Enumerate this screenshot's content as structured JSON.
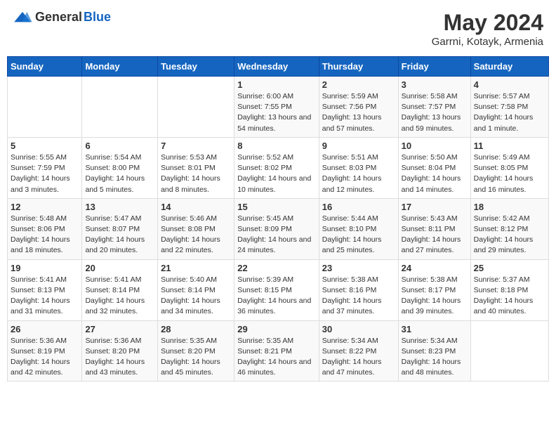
{
  "header": {
    "logo_general": "General",
    "logo_blue": "Blue",
    "title": "May 2024",
    "subtitle": "Garrni, Kotayk, Armenia"
  },
  "days_of_week": [
    "Sunday",
    "Monday",
    "Tuesday",
    "Wednesday",
    "Thursday",
    "Friday",
    "Saturday"
  ],
  "weeks": [
    [
      {
        "day": "",
        "sunrise": "",
        "sunset": "",
        "daylight": ""
      },
      {
        "day": "",
        "sunrise": "",
        "sunset": "",
        "daylight": ""
      },
      {
        "day": "",
        "sunrise": "",
        "sunset": "",
        "daylight": ""
      },
      {
        "day": "1",
        "sunrise": "Sunrise: 6:00 AM",
        "sunset": "Sunset: 7:55 PM",
        "daylight": "Daylight: 13 hours and 54 minutes."
      },
      {
        "day": "2",
        "sunrise": "Sunrise: 5:59 AM",
        "sunset": "Sunset: 7:56 PM",
        "daylight": "Daylight: 13 hours and 57 minutes."
      },
      {
        "day": "3",
        "sunrise": "Sunrise: 5:58 AM",
        "sunset": "Sunset: 7:57 PM",
        "daylight": "Daylight: 13 hours and 59 minutes."
      },
      {
        "day": "4",
        "sunrise": "Sunrise: 5:57 AM",
        "sunset": "Sunset: 7:58 PM",
        "daylight": "Daylight: 14 hours and 1 minute."
      }
    ],
    [
      {
        "day": "5",
        "sunrise": "Sunrise: 5:55 AM",
        "sunset": "Sunset: 7:59 PM",
        "daylight": "Daylight: 14 hours and 3 minutes."
      },
      {
        "day": "6",
        "sunrise": "Sunrise: 5:54 AM",
        "sunset": "Sunset: 8:00 PM",
        "daylight": "Daylight: 14 hours and 5 minutes."
      },
      {
        "day": "7",
        "sunrise": "Sunrise: 5:53 AM",
        "sunset": "Sunset: 8:01 PM",
        "daylight": "Daylight: 14 hours and 8 minutes."
      },
      {
        "day": "8",
        "sunrise": "Sunrise: 5:52 AM",
        "sunset": "Sunset: 8:02 PM",
        "daylight": "Daylight: 14 hours and 10 minutes."
      },
      {
        "day": "9",
        "sunrise": "Sunrise: 5:51 AM",
        "sunset": "Sunset: 8:03 PM",
        "daylight": "Daylight: 14 hours and 12 minutes."
      },
      {
        "day": "10",
        "sunrise": "Sunrise: 5:50 AM",
        "sunset": "Sunset: 8:04 PM",
        "daylight": "Daylight: 14 hours and 14 minutes."
      },
      {
        "day": "11",
        "sunrise": "Sunrise: 5:49 AM",
        "sunset": "Sunset: 8:05 PM",
        "daylight": "Daylight: 14 hours and 16 minutes."
      }
    ],
    [
      {
        "day": "12",
        "sunrise": "Sunrise: 5:48 AM",
        "sunset": "Sunset: 8:06 PM",
        "daylight": "Daylight: 14 hours and 18 minutes."
      },
      {
        "day": "13",
        "sunrise": "Sunrise: 5:47 AM",
        "sunset": "Sunset: 8:07 PM",
        "daylight": "Daylight: 14 hours and 20 minutes."
      },
      {
        "day": "14",
        "sunrise": "Sunrise: 5:46 AM",
        "sunset": "Sunset: 8:08 PM",
        "daylight": "Daylight: 14 hours and 22 minutes."
      },
      {
        "day": "15",
        "sunrise": "Sunrise: 5:45 AM",
        "sunset": "Sunset: 8:09 PM",
        "daylight": "Daylight: 14 hours and 24 minutes."
      },
      {
        "day": "16",
        "sunrise": "Sunrise: 5:44 AM",
        "sunset": "Sunset: 8:10 PM",
        "daylight": "Daylight: 14 hours and 25 minutes."
      },
      {
        "day": "17",
        "sunrise": "Sunrise: 5:43 AM",
        "sunset": "Sunset: 8:11 PM",
        "daylight": "Daylight: 14 hours and 27 minutes."
      },
      {
        "day": "18",
        "sunrise": "Sunrise: 5:42 AM",
        "sunset": "Sunset: 8:12 PM",
        "daylight": "Daylight: 14 hours and 29 minutes."
      }
    ],
    [
      {
        "day": "19",
        "sunrise": "Sunrise: 5:41 AM",
        "sunset": "Sunset: 8:13 PM",
        "daylight": "Daylight: 14 hours and 31 minutes."
      },
      {
        "day": "20",
        "sunrise": "Sunrise: 5:41 AM",
        "sunset": "Sunset: 8:14 PM",
        "daylight": "Daylight: 14 hours and 32 minutes."
      },
      {
        "day": "21",
        "sunrise": "Sunrise: 5:40 AM",
        "sunset": "Sunset: 8:14 PM",
        "daylight": "Daylight: 14 hours and 34 minutes."
      },
      {
        "day": "22",
        "sunrise": "Sunrise: 5:39 AM",
        "sunset": "Sunset: 8:15 PM",
        "daylight": "Daylight: 14 hours and 36 minutes."
      },
      {
        "day": "23",
        "sunrise": "Sunrise: 5:38 AM",
        "sunset": "Sunset: 8:16 PM",
        "daylight": "Daylight: 14 hours and 37 minutes."
      },
      {
        "day": "24",
        "sunrise": "Sunrise: 5:38 AM",
        "sunset": "Sunset: 8:17 PM",
        "daylight": "Daylight: 14 hours and 39 minutes."
      },
      {
        "day": "25",
        "sunrise": "Sunrise: 5:37 AM",
        "sunset": "Sunset: 8:18 PM",
        "daylight": "Daylight: 14 hours and 40 minutes."
      }
    ],
    [
      {
        "day": "26",
        "sunrise": "Sunrise: 5:36 AM",
        "sunset": "Sunset: 8:19 PM",
        "daylight": "Daylight: 14 hours and 42 minutes."
      },
      {
        "day": "27",
        "sunrise": "Sunrise: 5:36 AM",
        "sunset": "Sunset: 8:20 PM",
        "daylight": "Daylight: 14 hours and 43 minutes."
      },
      {
        "day": "28",
        "sunrise": "Sunrise: 5:35 AM",
        "sunset": "Sunset: 8:20 PM",
        "daylight": "Daylight: 14 hours and 45 minutes."
      },
      {
        "day": "29",
        "sunrise": "Sunrise: 5:35 AM",
        "sunset": "Sunset: 8:21 PM",
        "daylight": "Daylight: 14 hours and 46 minutes."
      },
      {
        "day": "30",
        "sunrise": "Sunrise: 5:34 AM",
        "sunset": "Sunset: 8:22 PM",
        "daylight": "Daylight: 14 hours and 47 minutes."
      },
      {
        "day": "31",
        "sunrise": "Sunrise: 5:34 AM",
        "sunset": "Sunset: 8:23 PM",
        "daylight": "Daylight: 14 hours and 48 minutes."
      },
      {
        "day": "",
        "sunrise": "",
        "sunset": "",
        "daylight": ""
      }
    ]
  ]
}
